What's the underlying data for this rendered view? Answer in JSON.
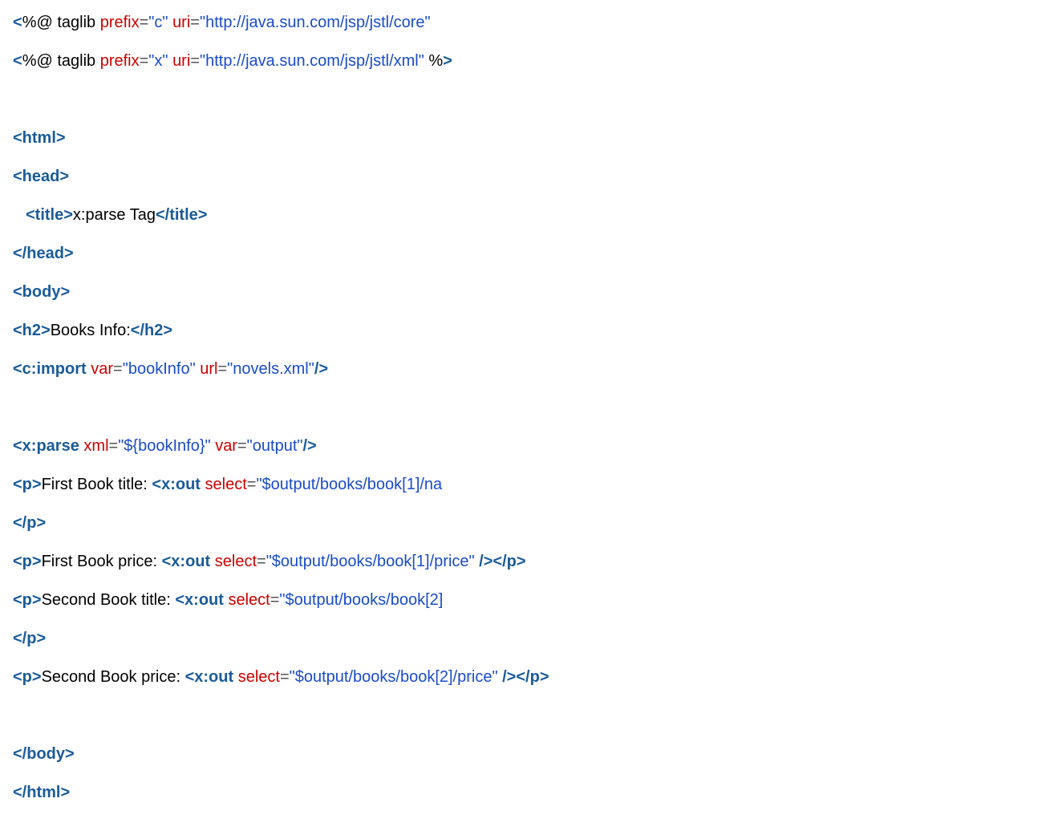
{
  "lines": [
    {
      "indent": false,
      "tokens": [
        {
          "cls": "tag",
          "t": "<"
        },
        {
          "cls": "txt",
          "t": "%@ taglib "
        },
        {
          "cls": "attr",
          "t": "prefix"
        },
        {
          "cls": "eq",
          "t": "="
        },
        {
          "cls": "str",
          "t": "\"c\""
        },
        {
          "cls": "txt",
          "t": " "
        },
        {
          "cls": "attr",
          "t": "uri"
        },
        {
          "cls": "eq",
          "t": "="
        },
        {
          "cls": "str",
          "t": "\"http://java.sun.com/jsp/jstl/core\""
        }
      ]
    },
    {
      "indent": false,
      "tokens": [
        {
          "cls": "tag",
          "t": "<"
        },
        {
          "cls": "txt",
          "t": "%@ taglib "
        },
        {
          "cls": "attr",
          "t": "prefix"
        },
        {
          "cls": "eq",
          "t": "="
        },
        {
          "cls": "str",
          "t": "\"x\""
        },
        {
          "cls": "txt",
          "t": " "
        },
        {
          "cls": "attr",
          "t": "uri"
        },
        {
          "cls": "eq",
          "t": "="
        },
        {
          "cls": "str",
          "t": "\"http://java.sun.com/jsp/jstl/xml\""
        },
        {
          "cls": "txt",
          "t": " %"
        },
        {
          "cls": "tag",
          "t": ">"
        }
      ]
    },
    {
      "indent": false,
      "tokens": [
        {
          "cls": "txt",
          "t": " "
        }
      ]
    },
    {
      "indent": false,
      "tokens": [
        {
          "cls": "tag",
          "t": "<html>"
        }
      ]
    },
    {
      "indent": false,
      "tokens": [
        {
          "cls": "tag",
          "t": "<head>"
        }
      ]
    },
    {
      "indent": true,
      "tokens": [
        {
          "cls": "tag",
          "t": "<title>"
        },
        {
          "cls": "txt",
          "t": "x:parse Tag"
        },
        {
          "cls": "tag",
          "t": "</title>"
        }
      ]
    },
    {
      "indent": false,
      "tokens": [
        {
          "cls": "tag",
          "t": "</head>"
        }
      ]
    },
    {
      "indent": false,
      "tokens": [
        {
          "cls": "tag",
          "t": "<body>"
        }
      ]
    },
    {
      "indent": false,
      "tokens": [
        {
          "cls": "tag",
          "t": "<h2>"
        },
        {
          "cls": "txt",
          "t": "Books Info:"
        },
        {
          "cls": "tag",
          "t": "</h2>"
        }
      ]
    },
    {
      "indent": false,
      "tokens": [
        {
          "cls": "tag",
          "t": "<c:import"
        },
        {
          "cls": "txt",
          "t": " "
        },
        {
          "cls": "attr",
          "t": "var"
        },
        {
          "cls": "eq",
          "t": "="
        },
        {
          "cls": "str",
          "t": "\"bookInfo\""
        },
        {
          "cls": "txt",
          "t": " "
        },
        {
          "cls": "attr",
          "t": "url"
        },
        {
          "cls": "eq",
          "t": "="
        },
        {
          "cls": "str",
          "t": "\"novels.xml\""
        },
        {
          "cls": "tag",
          "t": "/>"
        }
      ]
    },
    {
      "indent": false,
      "tokens": [
        {
          "cls": "txt",
          "t": " "
        }
      ]
    },
    {
      "indent": false,
      "tokens": [
        {
          "cls": "tag",
          "t": "<x:parse"
        },
        {
          "cls": "txt",
          "t": " "
        },
        {
          "cls": "attr",
          "t": "xml"
        },
        {
          "cls": "eq",
          "t": "="
        },
        {
          "cls": "str",
          "t": "\"${bookInfo}\""
        },
        {
          "cls": "txt",
          "t": " "
        },
        {
          "cls": "attr",
          "t": "var"
        },
        {
          "cls": "eq",
          "t": "="
        },
        {
          "cls": "str",
          "t": "\"output\""
        },
        {
          "cls": "tag",
          "t": "/>"
        }
      ]
    },
    {
      "indent": false,
      "tokens": [
        {
          "cls": "tag",
          "t": "<p>"
        },
        {
          "cls": "txt",
          "t": "First Book title: "
        },
        {
          "cls": "tag",
          "t": "<x:out"
        },
        {
          "cls": "txt",
          "t": " "
        },
        {
          "cls": "attr",
          "t": "select"
        },
        {
          "cls": "eq",
          "t": "="
        },
        {
          "cls": "str",
          "t": "\"$output/books/book[1]/na"
        }
      ]
    },
    {
      "indent": false,
      "tokens": [
        {
          "cls": "tag",
          "t": "</p>"
        }
      ]
    },
    {
      "indent": false,
      "tokens": [
        {
          "cls": "tag",
          "t": "<p>"
        },
        {
          "cls": "txt",
          "t": "First Book price: "
        },
        {
          "cls": "tag",
          "t": "<x:out"
        },
        {
          "cls": "txt",
          "t": " "
        },
        {
          "cls": "attr",
          "t": "select"
        },
        {
          "cls": "eq",
          "t": "="
        },
        {
          "cls": "str",
          "t": "\"$output/books/book[1]/price\""
        },
        {
          "cls": "txt",
          "t": " "
        },
        {
          "cls": "tag",
          "t": "/></p>"
        }
      ]
    },
    {
      "indent": false,
      "tokens": [
        {
          "cls": "tag",
          "t": "<p>"
        },
        {
          "cls": "txt",
          "t": "Second Book title: "
        },
        {
          "cls": "tag",
          "t": "<x:out"
        },
        {
          "cls": "txt",
          "t": " "
        },
        {
          "cls": "attr",
          "t": "select"
        },
        {
          "cls": "eq",
          "t": "="
        },
        {
          "cls": "str",
          "t": "\"$output/books/book[2]"
        }
      ]
    },
    {
      "indent": false,
      "tokens": [
        {
          "cls": "tag",
          "t": "</p>"
        }
      ]
    },
    {
      "indent": false,
      "tokens": [
        {
          "cls": "tag",
          "t": "<p>"
        },
        {
          "cls": "txt",
          "t": "Second Book price: "
        },
        {
          "cls": "tag",
          "t": "<x:out"
        },
        {
          "cls": "txt",
          "t": " "
        },
        {
          "cls": "attr",
          "t": "select"
        },
        {
          "cls": "eq",
          "t": "="
        },
        {
          "cls": "str",
          "t": "\"$output/books/book[2]/price\""
        },
        {
          "cls": "txt",
          "t": " "
        },
        {
          "cls": "tag",
          "t": "/></p>"
        }
      ]
    },
    {
      "indent": false,
      "tokens": [
        {
          "cls": "txt",
          "t": " "
        }
      ]
    },
    {
      "indent": false,
      "tokens": [
        {
          "cls": "tag",
          "t": "</body>"
        }
      ]
    },
    {
      "indent": false,
      "tokens": [
        {
          "cls": "tag",
          "t": "</html>"
        }
      ]
    }
  ]
}
